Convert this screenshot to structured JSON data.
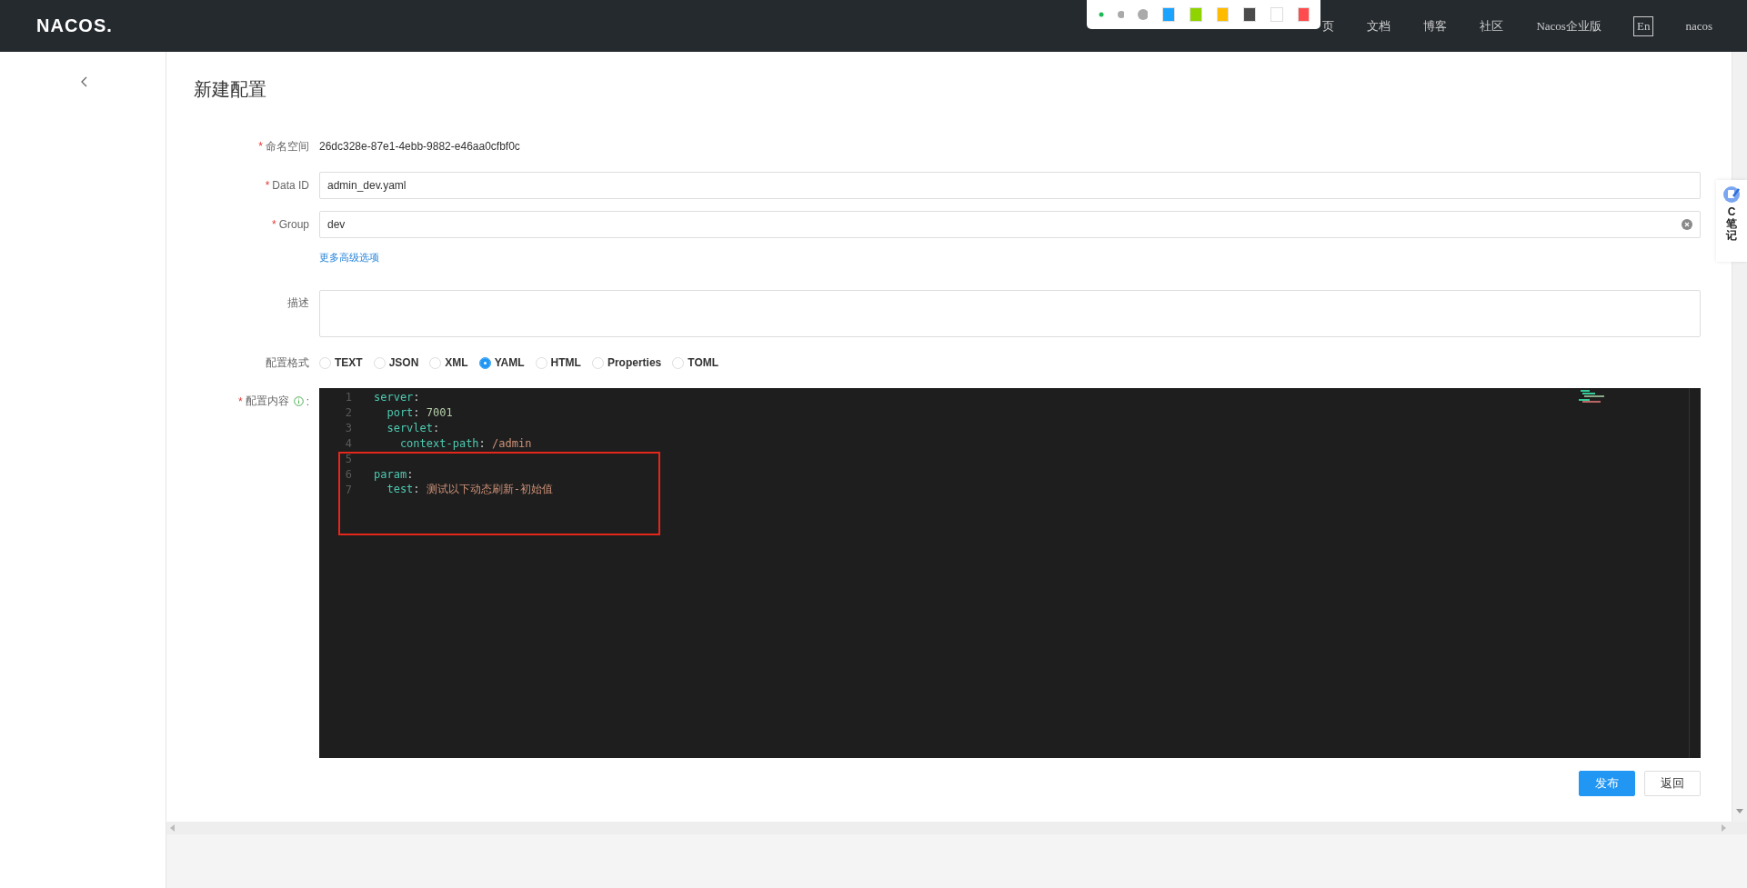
{
  "header": {
    "logo": "NACOS.",
    "nav": [
      {
        "label": "页",
        "boxed": false
      },
      {
        "label": "文档",
        "boxed": false
      },
      {
        "label": "博客",
        "boxed": false
      },
      {
        "label": "社区",
        "boxed": false
      },
      {
        "label": "Nacos企业版",
        "boxed": false
      },
      {
        "label": "En",
        "boxed": true
      },
      {
        "label": "nacos",
        "boxed": false
      }
    ]
  },
  "palette": {
    "swatches": [
      {
        "color": "#1aa3ff"
      },
      {
        "color": "#8fd400"
      },
      {
        "color": "#ffbb00"
      },
      {
        "color": "#4a4a4a"
      },
      {
        "color": "#ffffff"
      },
      {
        "color": "#ff4d4f"
      }
    ]
  },
  "page": {
    "title": "新建配置"
  },
  "form": {
    "namespace": {
      "label": "命名空间",
      "required_mark": "*",
      "value": "26dc328e-87e1-4ebb-9882-e46aa0cfbf0c"
    },
    "data_id": {
      "label": "Data ID",
      "required_mark": "*",
      "value": "admin_dev.yaml"
    },
    "group": {
      "label": "Group",
      "required_mark": "*",
      "value": "dev"
    },
    "advanced_link": "更多高级选项",
    "description": {
      "label": "描述"
    },
    "format": {
      "label": "配置格式",
      "options": [
        {
          "label": "TEXT",
          "selected": false
        },
        {
          "label": "JSON",
          "selected": false
        },
        {
          "label": "XML",
          "selected": false
        },
        {
          "label": "YAML",
          "selected": true
        },
        {
          "label": "HTML",
          "selected": false
        },
        {
          "label": "Properties",
          "selected": false
        },
        {
          "label": "TOML",
          "selected": false
        }
      ]
    },
    "content": {
      "label": "配置内容",
      "required_mark": "*",
      "suffix": ":",
      "lines": [
        {
          "number": "1",
          "tokens": [
            {
              "kind": "key",
              "text": "server"
            },
            {
              "kind": "punct",
              "text": ":"
            }
          ]
        },
        {
          "number": "2",
          "tokens": [
            {
              "kind": "key",
              "text": "  port"
            },
            {
              "kind": "punct",
              "text": ": "
            },
            {
              "kind": "number",
              "text": "7001"
            }
          ]
        },
        {
          "number": "3",
          "tokens": [
            {
              "kind": "key",
              "text": "  servlet"
            },
            {
              "kind": "punct",
              "text": ":"
            }
          ]
        },
        {
          "number": "4",
          "tokens": [
            {
              "kind": "key",
              "text": "    context-path"
            },
            {
              "kind": "punct",
              "text": ": "
            },
            {
              "kind": "string",
              "text": "/admin"
            }
          ]
        },
        {
          "number": "5"
        },
        {
          "number": "6",
          "tokens": [
            {
              "kind": "key",
              "text": "param"
            },
            {
              "kind": "punct",
              "text": ":"
            }
          ]
        },
        {
          "number": "7",
          "tokens": [
            {
              "kind": "key",
              "text": "  test"
            },
            {
              "kind": "punct",
              "text": ": "
            },
            {
              "kind": "string",
              "text": "测试以下动态刷新-初始值"
            }
          ]
        }
      ]
    }
  },
  "buttons": [
    {
      "label": "发布",
      "primary": true
    },
    {
      "label": "返回",
      "primary": false
    }
  ],
  "side_widget": {
    "letter": "C",
    "label": "笔记"
  }
}
